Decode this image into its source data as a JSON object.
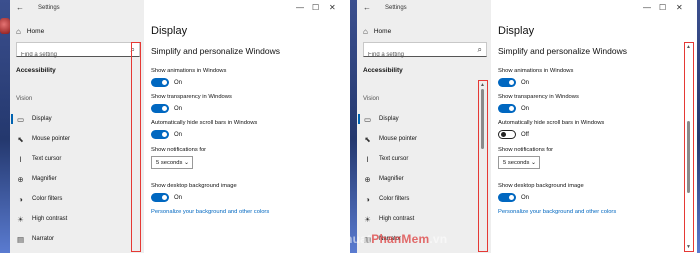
{
  "app_title": "Settings",
  "nav": {
    "home_label": "Home",
    "search_placeholder": "Find a setting",
    "category": "Accessibility",
    "group": "Vision",
    "items": [
      {
        "label": "Display",
        "icon": "display-icon",
        "selected": true
      },
      {
        "label": "Mouse pointer",
        "icon": "mouse-pointer-icon",
        "selected": false
      },
      {
        "label": "Text cursor",
        "icon": "text-cursor-icon",
        "selected": false
      },
      {
        "label": "Magnifier",
        "icon": "magnifier-icon",
        "selected": false
      },
      {
        "label": "Color filters",
        "icon": "color-filters-icon",
        "selected": false
      },
      {
        "label": "High contrast",
        "icon": "high-contrast-icon",
        "selected": false
      },
      {
        "label": "Narrator",
        "icon": "narrator-icon",
        "selected": false
      }
    ]
  },
  "main": {
    "title": "Display",
    "subtitle": "Simplify and personalize Windows",
    "animations_label": "Show animations in Windows",
    "transparency_label": "Show transparency in Windows",
    "scrollbars_label": "Automatically hide scroll bars in Windows",
    "notifications_label": "Show notifications for",
    "notifications_value": "5 seconds",
    "background_label": "Show desktop background image",
    "link_text": "Personalize your background and other colors",
    "on_text": "On",
    "off_text": "Off"
  },
  "windows": [
    {
      "animations": true,
      "transparency": true,
      "hide_scrollbars": true,
      "background": true
    },
    {
      "animations": true,
      "transparency": true,
      "hide_scrollbars": false,
      "background": true
    }
  ],
  "highlight_color": "#e53935",
  "accent_color": "#0067c0",
  "watermark": {
    "part1": "ThuThuat",
    "part2": "PhanMem",
    "part3": ".vn"
  }
}
